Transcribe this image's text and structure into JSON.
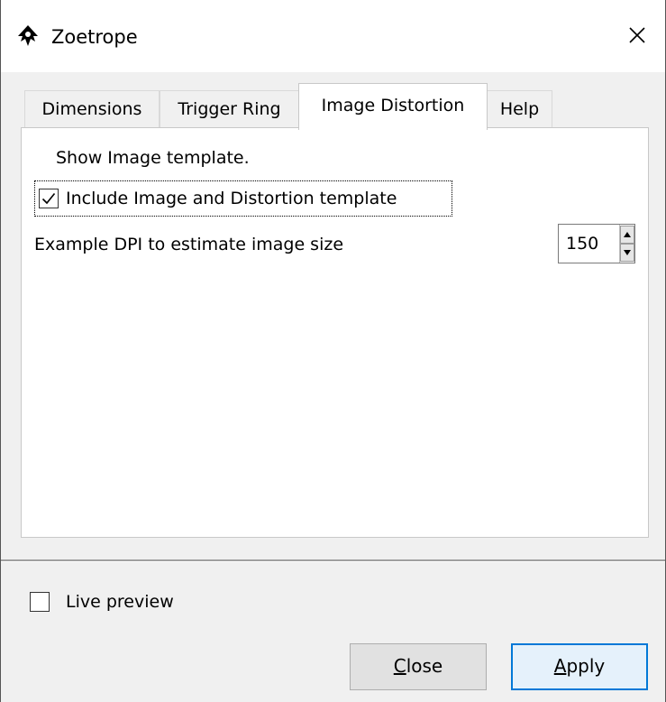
{
  "window": {
    "title": "Zoetrope",
    "app_icon": "inkscape-icon",
    "close_icon": "close-icon",
    "close_glyph": "✕"
  },
  "tabs": [
    {
      "label": "Dimensions",
      "active": false
    },
    {
      "label": "Trigger Ring",
      "active": false
    },
    {
      "label": "Image Distortion",
      "active": true
    },
    {
      "label": "Help",
      "active": false
    }
  ],
  "panel": {
    "show_template_label": "Show Image template.",
    "include_template": {
      "label": "Include Image and Distortion template",
      "checked": true
    },
    "dpi": {
      "label": "Example DPI to estimate image size",
      "value": "150"
    }
  },
  "footer": {
    "live_preview": {
      "label": "Live preview",
      "checked": false
    },
    "close_button": {
      "mnemonic": "C",
      "rest": "lose"
    },
    "apply_button": {
      "mnemonic": "A",
      "rest": "pply"
    }
  },
  "colors": {
    "accent": "#0078d7",
    "window_bg": "#f0f0f0"
  }
}
